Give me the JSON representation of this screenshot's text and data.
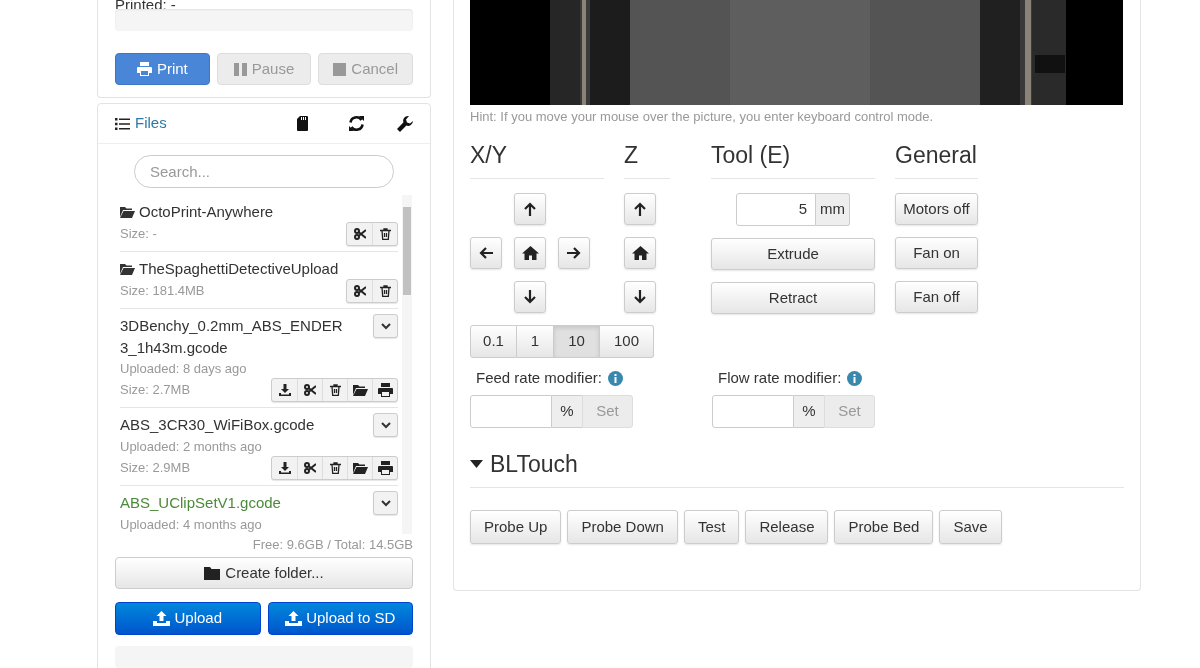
{
  "state_panel": {
    "printed_label": "Printed: -",
    "progress": {
      "level": 0
    },
    "buttons": [
      {
        "label": "Print",
        "kind": "primary"
      },
      {
        "label": "Pause",
        "kind": "default"
      },
      {
        "label": "Cancel",
        "kind": "default"
      }
    ]
  },
  "files": {
    "title": "Files",
    "search": {
      "placeholder": "Search..."
    },
    "items": [
      {
        "kind": "folder",
        "name": "OctoPrint-Anywhere",
        "size": "Size: -",
        "printed": false
      },
      {
        "kind": "folder",
        "name": "TheSpaghettiDetectiveUpload",
        "size": "Size: 181.4MB",
        "printed": false
      },
      {
        "kind": "file",
        "name": "3DBenchy_0.2mm_ABS_ENDER3_1h43m.gcode",
        "uploaded": "Uploaded: 8 days ago",
        "size": "Size: 2.7MB",
        "printed": false
      },
      {
        "kind": "file",
        "name": "ABS_3CR30_WiFiBox.gcode",
        "uploaded": "Uploaded: 2 months ago",
        "size": "Size: 2.9MB",
        "printed": false
      },
      {
        "kind": "file",
        "name": "ABS_UClipSetV1.gcode",
        "uploaded": "Uploaded: 4 months ago",
        "printed": true
      }
    ],
    "storage": "Free: 9.6GB / Total: 14.5GB",
    "create_folder": "Create folder...",
    "upload_buttons": [
      "Upload",
      "Upload to SD"
    ],
    "upload_progress": {
      "level": 0
    }
  },
  "control": {
    "hint": "Hint: If you move your mouse over the picture, you enter keyboard control mode.",
    "headings": [
      "X/Y",
      "Z",
      "Tool (E)",
      "General"
    ],
    "distances": [
      {
        "label": "0.1",
        "selected": false
      },
      {
        "label": "1",
        "selected": false
      },
      {
        "label": "10",
        "selected": true
      },
      {
        "label": "100",
        "selected": false
      }
    ],
    "extrude_amount": "5",
    "unit": "mm",
    "tool_buttons": [
      "Extrude",
      "Retract"
    ],
    "general_buttons": [
      "Motors off",
      "Fan on",
      "Fan off"
    ],
    "feed_rate": {
      "label": "Feed rate modifier:",
      "unit": "%",
      "button": "Set"
    },
    "flow_rate": {
      "label": "Flow rate modifier:",
      "unit": "%",
      "button": "Set"
    },
    "bltouch": {
      "title": "BLTouch",
      "expanded": true,
      "buttons": [
        "Probe Up",
        "Probe Down",
        "Test",
        "Release",
        "Probe Bed",
        "Save"
      ]
    }
  }
}
